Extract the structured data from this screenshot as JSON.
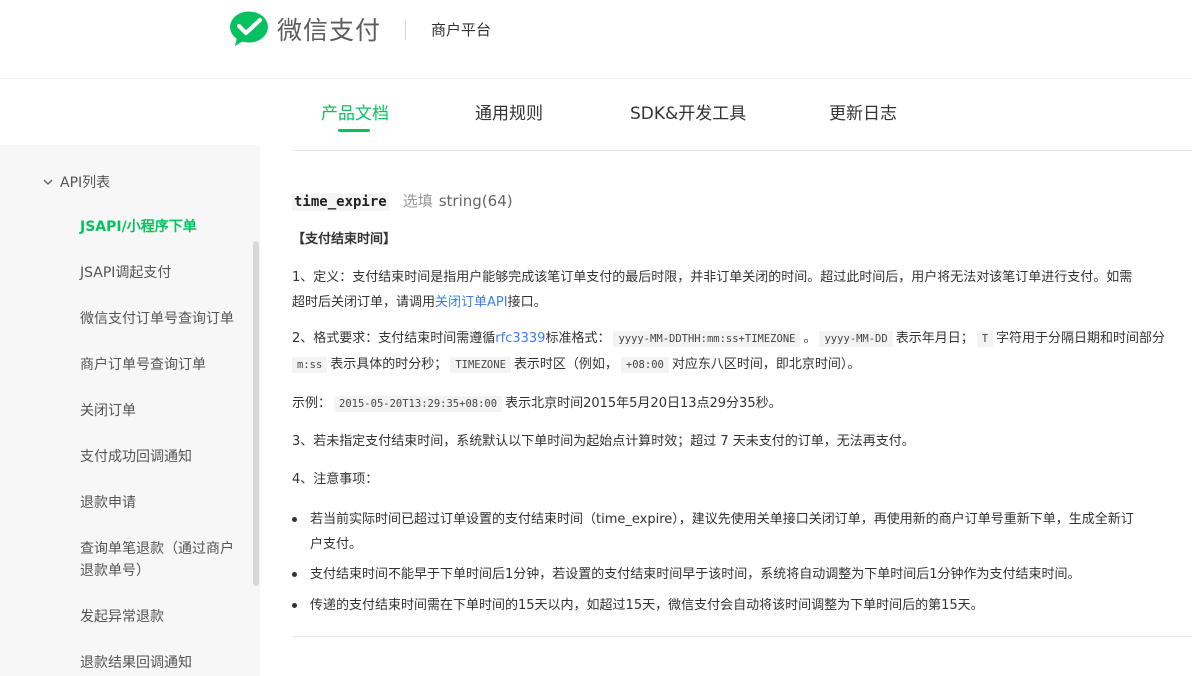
{
  "header": {
    "brand_name": "微信支付",
    "platform_label": "商户平台",
    "brand_color": "#07c160"
  },
  "nav": {
    "tabs": [
      {
        "label": "产品文档",
        "active": true
      },
      {
        "label": "通用规则",
        "active": false
      },
      {
        "label": "SDK&开发工具",
        "active": false
      },
      {
        "label": "更新日志",
        "active": false
      }
    ]
  },
  "sidebar": {
    "group_label": "API列表",
    "items": [
      {
        "label": "JSAPI/小程序下单",
        "active": true
      },
      {
        "label": "JSAPI调起支付",
        "active": false
      },
      {
        "label": "微信支付订单号查询订单",
        "active": false
      },
      {
        "label": "商户订单号查询订单",
        "active": false
      },
      {
        "label": "关闭订单",
        "active": false
      },
      {
        "label": "支付成功回调通知",
        "active": false
      },
      {
        "label": "退款申请",
        "active": false
      },
      {
        "label": "查询单笔退款（通过商户",
        "label2": "退款单号）",
        "active": false
      },
      {
        "label": "发起异常退款",
        "active": false
      },
      {
        "label": "退款结果回调通知",
        "active": false
      }
    ]
  },
  "content": {
    "field_name": "time_expire",
    "field_required": "选填",
    "field_type": "string(64)",
    "section_title": "【支付结束时间】",
    "p1": {
      "line1": "1、定义：支付结束时间是指用户能够完成该笔订单支付的最后时限，并非订单关闭的时间。超过此时间后，用户将无法对该笔订单进行支付。如需",
      "line2_before": "超时后关闭订单，请调用",
      "line2_link": "关闭订单API",
      "line2_after": "接口。"
    },
    "p2": {
      "a": "2、格式要求：支付结束时间需遵循",
      "link": "rfc3339",
      "b": "标准格式：",
      "code1": "yyyy-MM-DDTHH:mm:ss+TIMEZONE",
      "c": "。",
      "code2": "yyyy-MM-DD",
      "d": "表示年月日；",
      "code3": "T",
      "e": "字符用于分隔日期和时间部分",
      "code4": "m:ss",
      "f": "表示具体的时分秒；",
      "code5": "TIMEZONE",
      "g": "表示时区（例如，",
      "code6": "+08:00",
      "h": "对应东八区时间，即北京时间）。"
    },
    "example": {
      "label": "示例：",
      "code": "2015-05-20T13:29:35+08:00",
      "text": "表示北京时间2015年5月20日13点29分35秒。"
    },
    "p3": "3、若未指定支付结束时间，系统默认以下单时间为起始点计算时效；超过 7 天未支付的订单，无法再支付。",
    "p4_title": "4、注意事项：",
    "bullets": [
      {
        "line1": "若当前实际时间已超过订单设置的支付结束时间（time_expire），建议先使用关单接口关闭订单，再使用新的商户订单号重新下单，生成全新订",
        "line2": "户支付。"
      },
      {
        "line1": "支付结束时间不能早于下单时间后1分钟，若设置的支付结束时间早于该时间，系统将自动调整为下单时间后1分钟作为支付结束时间。"
      },
      {
        "line1": "传递的支付结束时间需在下单时间的15天以内，如超过15天，微信支付会自动将该时间调整为下单时间后的第15天。"
      }
    ]
  }
}
